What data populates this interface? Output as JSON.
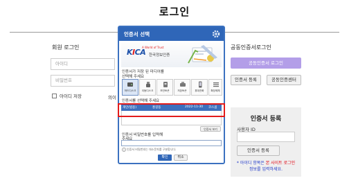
{
  "page": {
    "title": "로그인"
  },
  "member_login": {
    "heading": "회원 로그인",
    "id_placeholder": "아이디",
    "pw_placeholder": "비밀번호",
    "remember_label": "아이디 저장",
    "partial_link": "의이"
  },
  "public_cert": {
    "heading": "공동인증서로그인",
    "login_button": "공동인증서 로그인",
    "register_button": "인증서 등록",
    "center_button": "공동인증센터"
  },
  "cert_register": {
    "title": "인증서 등록",
    "user_id_label": "사용자 ID",
    "register_button": "인증서 등록",
    "notice_prefix": "* 아이디 항목은 ",
    "notice_highlight": "본 사이트 로그인",
    "notice_suffix": "정보를 입력하세요."
  },
  "modal": {
    "title": "인증서 선택",
    "banner_tagline": "A World of Trust",
    "banner_brand": "한국정보인증",
    "media_label_line1": "인증서가 저장 된 미디어를",
    "media_label_line2": "선택해 주세요",
    "media": [
      "하드디스크",
      "이동디스크",
      "보안토큰",
      "저장토큰",
      "휴대전화",
      "확장매체"
    ],
    "cert_select_label": "인증서를 선택해 주세요",
    "cert_row": {
      "type": "개인(범용)",
      "owner": "홍길동",
      "expiry": "2022-11-30",
      "issuer": "코스콤"
    },
    "view_cert_button": "인증서 보기",
    "password_label_line1": "인증서 비밀번호를 입력해",
    "password_label_line2": "주세요",
    "password_hint": "인증서 비밀번호는 대소문자를 구분합니다.",
    "ok_button": "확인",
    "cancel_button": "취소"
  },
  "colors": {
    "modal_blue": "#2f66b8",
    "highlight_red": "#e21b1b",
    "accent_purple": "#b39ee8",
    "notice_red": "#e0000e",
    "notice_blue": "#1f37c8"
  }
}
